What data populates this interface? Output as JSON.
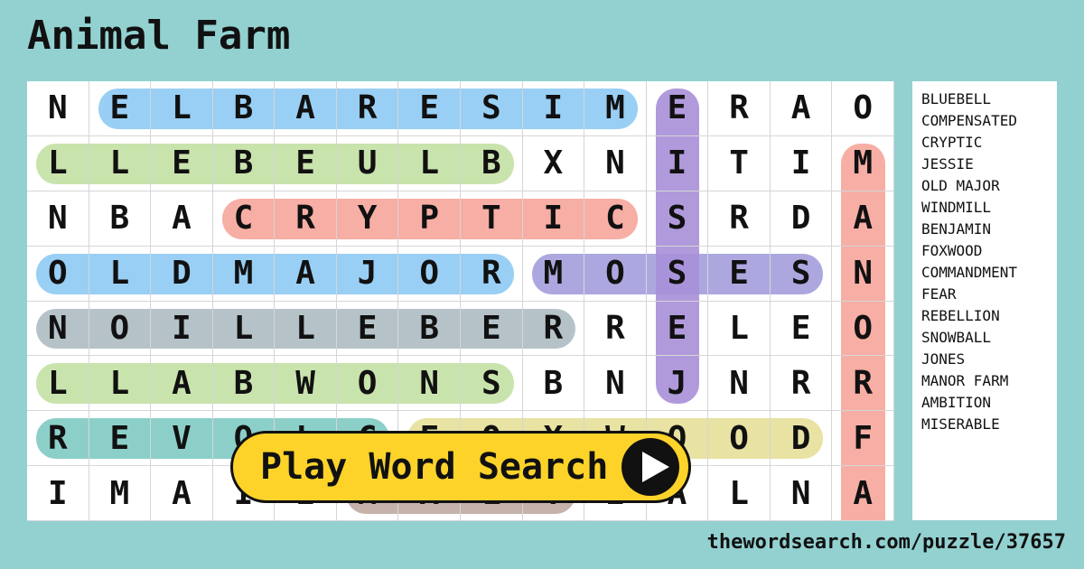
{
  "title": "Animal Farm",
  "grid": [
    "NELBARESIMERAO",
    "LLEBEULBXNITIM",
    "NBACRYPTICSRDA",
    "OLDMAJORMOSESN",
    "NOILLEBERRELEO",
    "LLABWONSBNJNRR",
    "REVOLCFOXWOODF",
    "IMAIEMALTEALNA"
  ],
  "highlights": [
    {
      "row": 0,
      "col": 1,
      "row2": 0,
      "col2": 9,
      "color": "#8ecaf4"
    },
    {
      "row": 1,
      "col": 0,
      "row2": 1,
      "col2": 7,
      "color": "#c3e0a4"
    },
    {
      "row": 2,
      "col": 3,
      "row2": 2,
      "col2": 9,
      "color": "#f6a59b"
    },
    {
      "row": 3,
      "col": 0,
      "row2": 3,
      "col2": 7,
      "color": "#8ecaf4"
    },
    {
      "row": 3,
      "col": 8,
      "row2": 3,
      "col2": 12,
      "color": "#a39fdc"
    },
    {
      "row": 0,
      "col": 10,
      "row2": 5,
      "col2": 10,
      "color": "#a78fd8"
    },
    {
      "row": 4,
      "col": 0,
      "row2": 4,
      "col2": 8,
      "color": "#adbcc3"
    },
    {
      "row": 5,
      "col": 0,
      "row2": 5,
      "col2": 7,
      "color": "#c3e0a4"
    },
    {
      "row": 6,
      "col": 0,
      "row2": 6,
      "col2": 5,
      "color": "#7fcac3"
    },
    {
      "row": 6,
      "col": 6,
      "row2": 6,
      "col2": 12,
      "color": "#e6df99"
    },
    {
      "row": 1,
      "col": 13,
      "row2": 8,
      "col2": 13,
      "color": "#f6a59b"
    },
    {
      "row": 7,
      "col": 5,
      "row2": 7,
      "col2": 8,
      "color": "#c0aaa2"
    }
  ],
  "words": [
    "BLUEBELL",
    "COMPENSATED",
    "CRYPTIC",
    "JESSIE",
    "OLD MAJOR",
    "WINDMILL",
    "BENJAMIN",
    "FOXWOOD",
    "COMMANDMENT",
    "FEAR",
    "REBELLION",
    "SNOWBALL",
    "JONES",
    "MANOR FARM",
    "AMBITION",
    "MISERABLE"
  ],
  "play_button": {
    "label": "Play Word Search",
    "icon": "play-icon"
  },
  "footer": "thewordsearch.com/puzzle/37657"
}
